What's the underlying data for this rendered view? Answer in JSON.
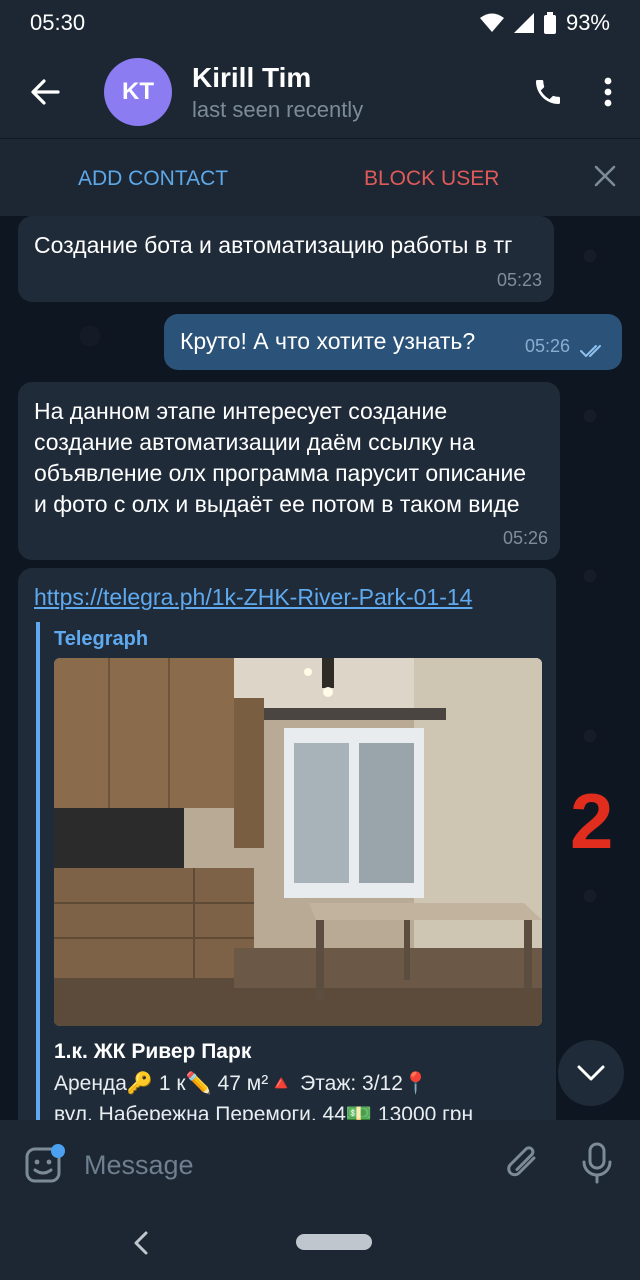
{
  "status_bar": {
    "time": "05:30",
    "battery": "93%"
  },
  "header": {
    "avatar_initials": "KT",
    "avatar_color": "#8b7cf1",
    "title": "Kirill Tim",
    "subtitle": "last seen recently",
    "icons": [
      "back-arrow-icon",
      "phone-icon",
      "more-vertical-icon"
    ]
  },
  "action_bar": {
    "add_contact": "ADD CONTACT",
    "block_user": "BLOCK USER"
  },
  "messages": [
    {
      "direction": "in",
      "text": "Создание бота и автоматизацию работы в тг",
      "time": "05:23"
    },
    {
      "direction": "out",
      "text": "Круто! А что хотите узнать?",
      "time": "05:26",
      "status": "read"
    },
    {
      "direction": "in",
      "text": "На данном этапе интересует создание создание автоматизации даём ссылку на объявление олх программа парусит описание и фото с олх и выдаёт ее потом в таком виде",
      "time": "05:26"
    },
    {
      "direction": "in",
      "link": "https://telegra.ph/1k-ZHK-River-Park-01-14",
      "preview": {
        "site": "Telegraph",
        "title": "1.к. ЖК Ривер Парк",
        "description_line1": "Аренда🔑 1 к✏️ 47 м²🔺 Этаж: 3/12📍",
        "description_line2": "вул. Набережна Перемоги, 44💵 13000 грн"
      }
    }
  ],
  "overlay_number": "2",
  "input": {
    "placeholder": "Message"
  },
  "colors": {
    "background": "#0e1621",
    "header": "#1c2733",
    "incoming": "#1f2b38",
    "outgoing": "#2b5278",
    "accent": "#5ea8e8",
    "danger": "#e05a5a"
  }
}
